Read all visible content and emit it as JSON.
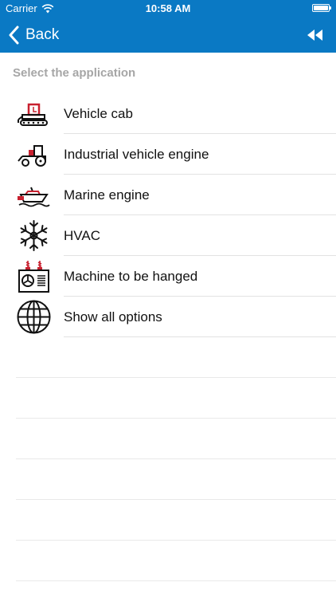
{
  "status_bar": {
    "carrier": "Carrier",
    "time": "10:58 AM"
  },
  "nav": {
    "back_label": "Back"
  },
  "section_title": "Select the application",
  "items": [
    {
      "label": "Vehicle cab",
      "icon": "vehicle-cab-icon"
    },
    {
      "label": "Industrial vehicle engine",
      "icon": "tractor-icon"
    },
    {
      "label": "Marine engine",
      "icon": "boat-icon"
    },
    {
      "label": "HVAC",
      "icon": "snowflake-icon"
    },
    {
      "label": "Machine to be hanged",
      "icon": "machine-icon"
    },
    {
      "label": "Show all options",
      "icon": "globe-icon"
    }
  ],
  "colors": {
    "nav_background": "#0a79c4",
    "accent_red": "#c8202f",
    "section_title": "#a6a6a6",
    "separator": "#e2e2e2"
  }
}
